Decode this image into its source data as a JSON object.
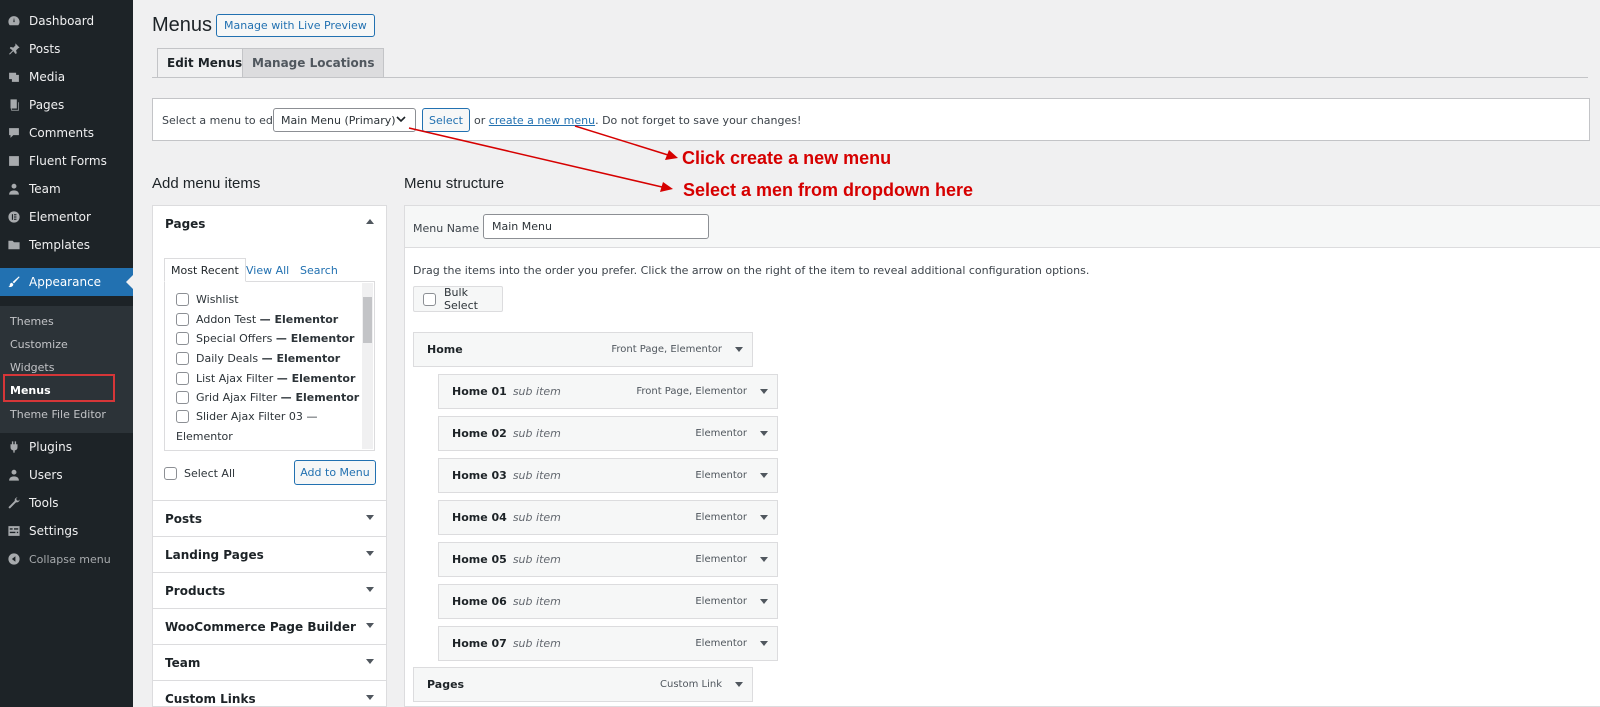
{
  "sidebar": {
    "items": [
      {
        "label": "Dashboard",
        "icon": "dashboard-icon"
      },
      {
        "label": "Posts",
        "icon": "pin-icon"
      },
      {
        "label": "Media",
        "icon": "media-icon"
      },
      {
        "label": "Pages",
        "icon": "pages-icon"
      },
      {
        "label": "Comments",
        "icon": "comment-icon"
      },
      {
        "label": "Fluent Forms",
        "icon": "forms-icon"
      },
      {
        "label": "Team",
        "icon": "user-icon"
      },
      {
        "label": "Elementor",
        "icon": "elementor-icon"
      },
      {
        "label": "Templates",
        "icon": "folder-icon"
      },
      {
        "label": "Appearance",
        "icon": "brush-icon"
      },
      {
        "label": "Plugins",
        "icon": "plugin-icon"
      },
      {
        "label": "Users",
        "icon": "users-icon"
      },
      {
        "label": "Tools",
        "icon": "wrench-icon"
      },
      {
        "label": "Settings",
        "icon": "settings-icon"
      }
    ],
    "submenu": [
      "Themes",
      "Customize",
      "Widgets",
      "Menus",
      "Theme File Editor"
    ],
    "collapse_label": "Collapse menu"
  },
  "header": {
    "title": "Menus",
    "live_preview": "Manage with Live Preview",
    "tabs": [
      "Edit Menus",
      "Manage Locations"
    ]
  },
  "select_bar": {
    "label": "Select a menu to edit:",
    "selected_menu": "Main Menu (Primary)",
    "select_button": "Select",
    "or_text": "or",
    "create_link": "create a new menu",
    "save_hint": ". Do not forget to save your changes!"
  },
  "annotations": {
    "create": "Click create a new menu",
    "dropdown": "Select a men from dropdown here"
  },
  "add_items": {
    "heading": "Add menu items",
    "pages_panel": {
      "title": "Pages",
      "tabs": [
        "Most Recent",
        "View All",
        "Search"
      ],
      "list": [
        {
          "name": "Wishlist",
          "suffix": ""
        },
        {
          "name": "Addon Test",
          "suffix": "— Elementor"
        },
        {
          "name": "Special Offers",
          "suffix": "— Elementor"
        },
        {
          "name": "Daily Deals",
          "suffix": "— Elementor"
        },
        {
          "name": "List Ajax Filter",
          "suffix": "— Elementor"
        },
        {
          "name": "Grid Ajax Filter",
          "suffix": "— Elementor"
        },
        {
          "name": "Slider Ajax Filter 03",
          "suffix": "—"
        }
      ],
      "wrap_line": "Elementor",
      "select_all": "Select All",
      "add_button": "Add to Menu"
    },
    "other_panels": [
      "Posts",
      "Landing Pages",
      "Products",
      "WooCommerce Page Builder",
      "Team",
      "Custom Links"
    ]
  },
  "structure": {
    "heading": "Menu structure",
    "menu_name_label": "Menu Name",
    "menu_name_value": "Main Menu",
    "help": "Drag the items into the order you prefer. Click the arrow on the right of the item to reveal additional configuration options.",
    "bulk_select": "Bulk Select",
    "items": [
      {
        "title": "Home",
        "sub": "",
        "type": "Front Page, Elementor"
      },
      {
        "title": "Home 01",
        "sub": "sub item",
        "type": "Front Page, Elementor"
      },
      {
        "title": "Home 02",
        "sub": "sub item",
        "type": "Elementor"
      },
      {
        "title": "Home 03",
        "sub": "sub item",
        "type": "Elementor"
      },
      {
        "title": "Home 04",
        "sub": "sub item",
        "type": "Elementor"
      },
      {
        "title": "Home 05",
        "sub": "sub item",
        "type": "Elementor"
      },
      {
        "title": "Home 06",
        "sub": "sub item",
        "type": "Elementor"
      },
      {
        "title": "Home 07",
        "sub": "sub item",
        "type": "Elementor"
      },
      {
        "title": "Pages",
        "sub": "",
        "type": "Custom Link"
      }
    ]
  },
  "colors": {
    "sidebar": "#1d2327",
    "accent": "#2271b1",
    "annotation": "#d60000"
  }
}
